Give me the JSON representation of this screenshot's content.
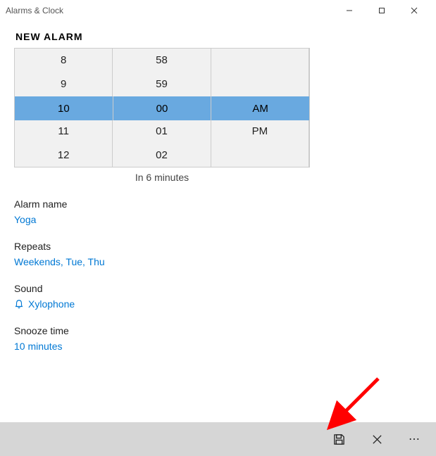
{
  "window": {
    "title": "Alarms & Clock"
  },
  "page": {
    "heading": "NEW ALARM",
    "timeHint": "In 6 minutes"
  },
  "picker": {
    "hours": [
      "8",
      "9",
      "10",
      "11",
      "12"
    ],
    "minutes": [
      "58",
      "59",
      "00",
      "01",
      "02"
    ],
    "ampm": [
      "",
      "",
      "AM",
      "PM",
      ""
    ],
    "selected": {
      "hour": "10",
      "minute": "00",
      "ampm": "AM"
    }
  },
  "fields": {
    "nameLabel": "Alarm name",
    "nameValue": "Yoga",
    "repeatsLabel": "Repeats",
    "repeatsValue": "Weekends, Tue, Thu",
    "soundLabel": "Sound",
    "soundValue": "Xylophone",
    "snoozeLabel": "Snooze time",
    "snoozeValue": "10 minutes"
  }
}
